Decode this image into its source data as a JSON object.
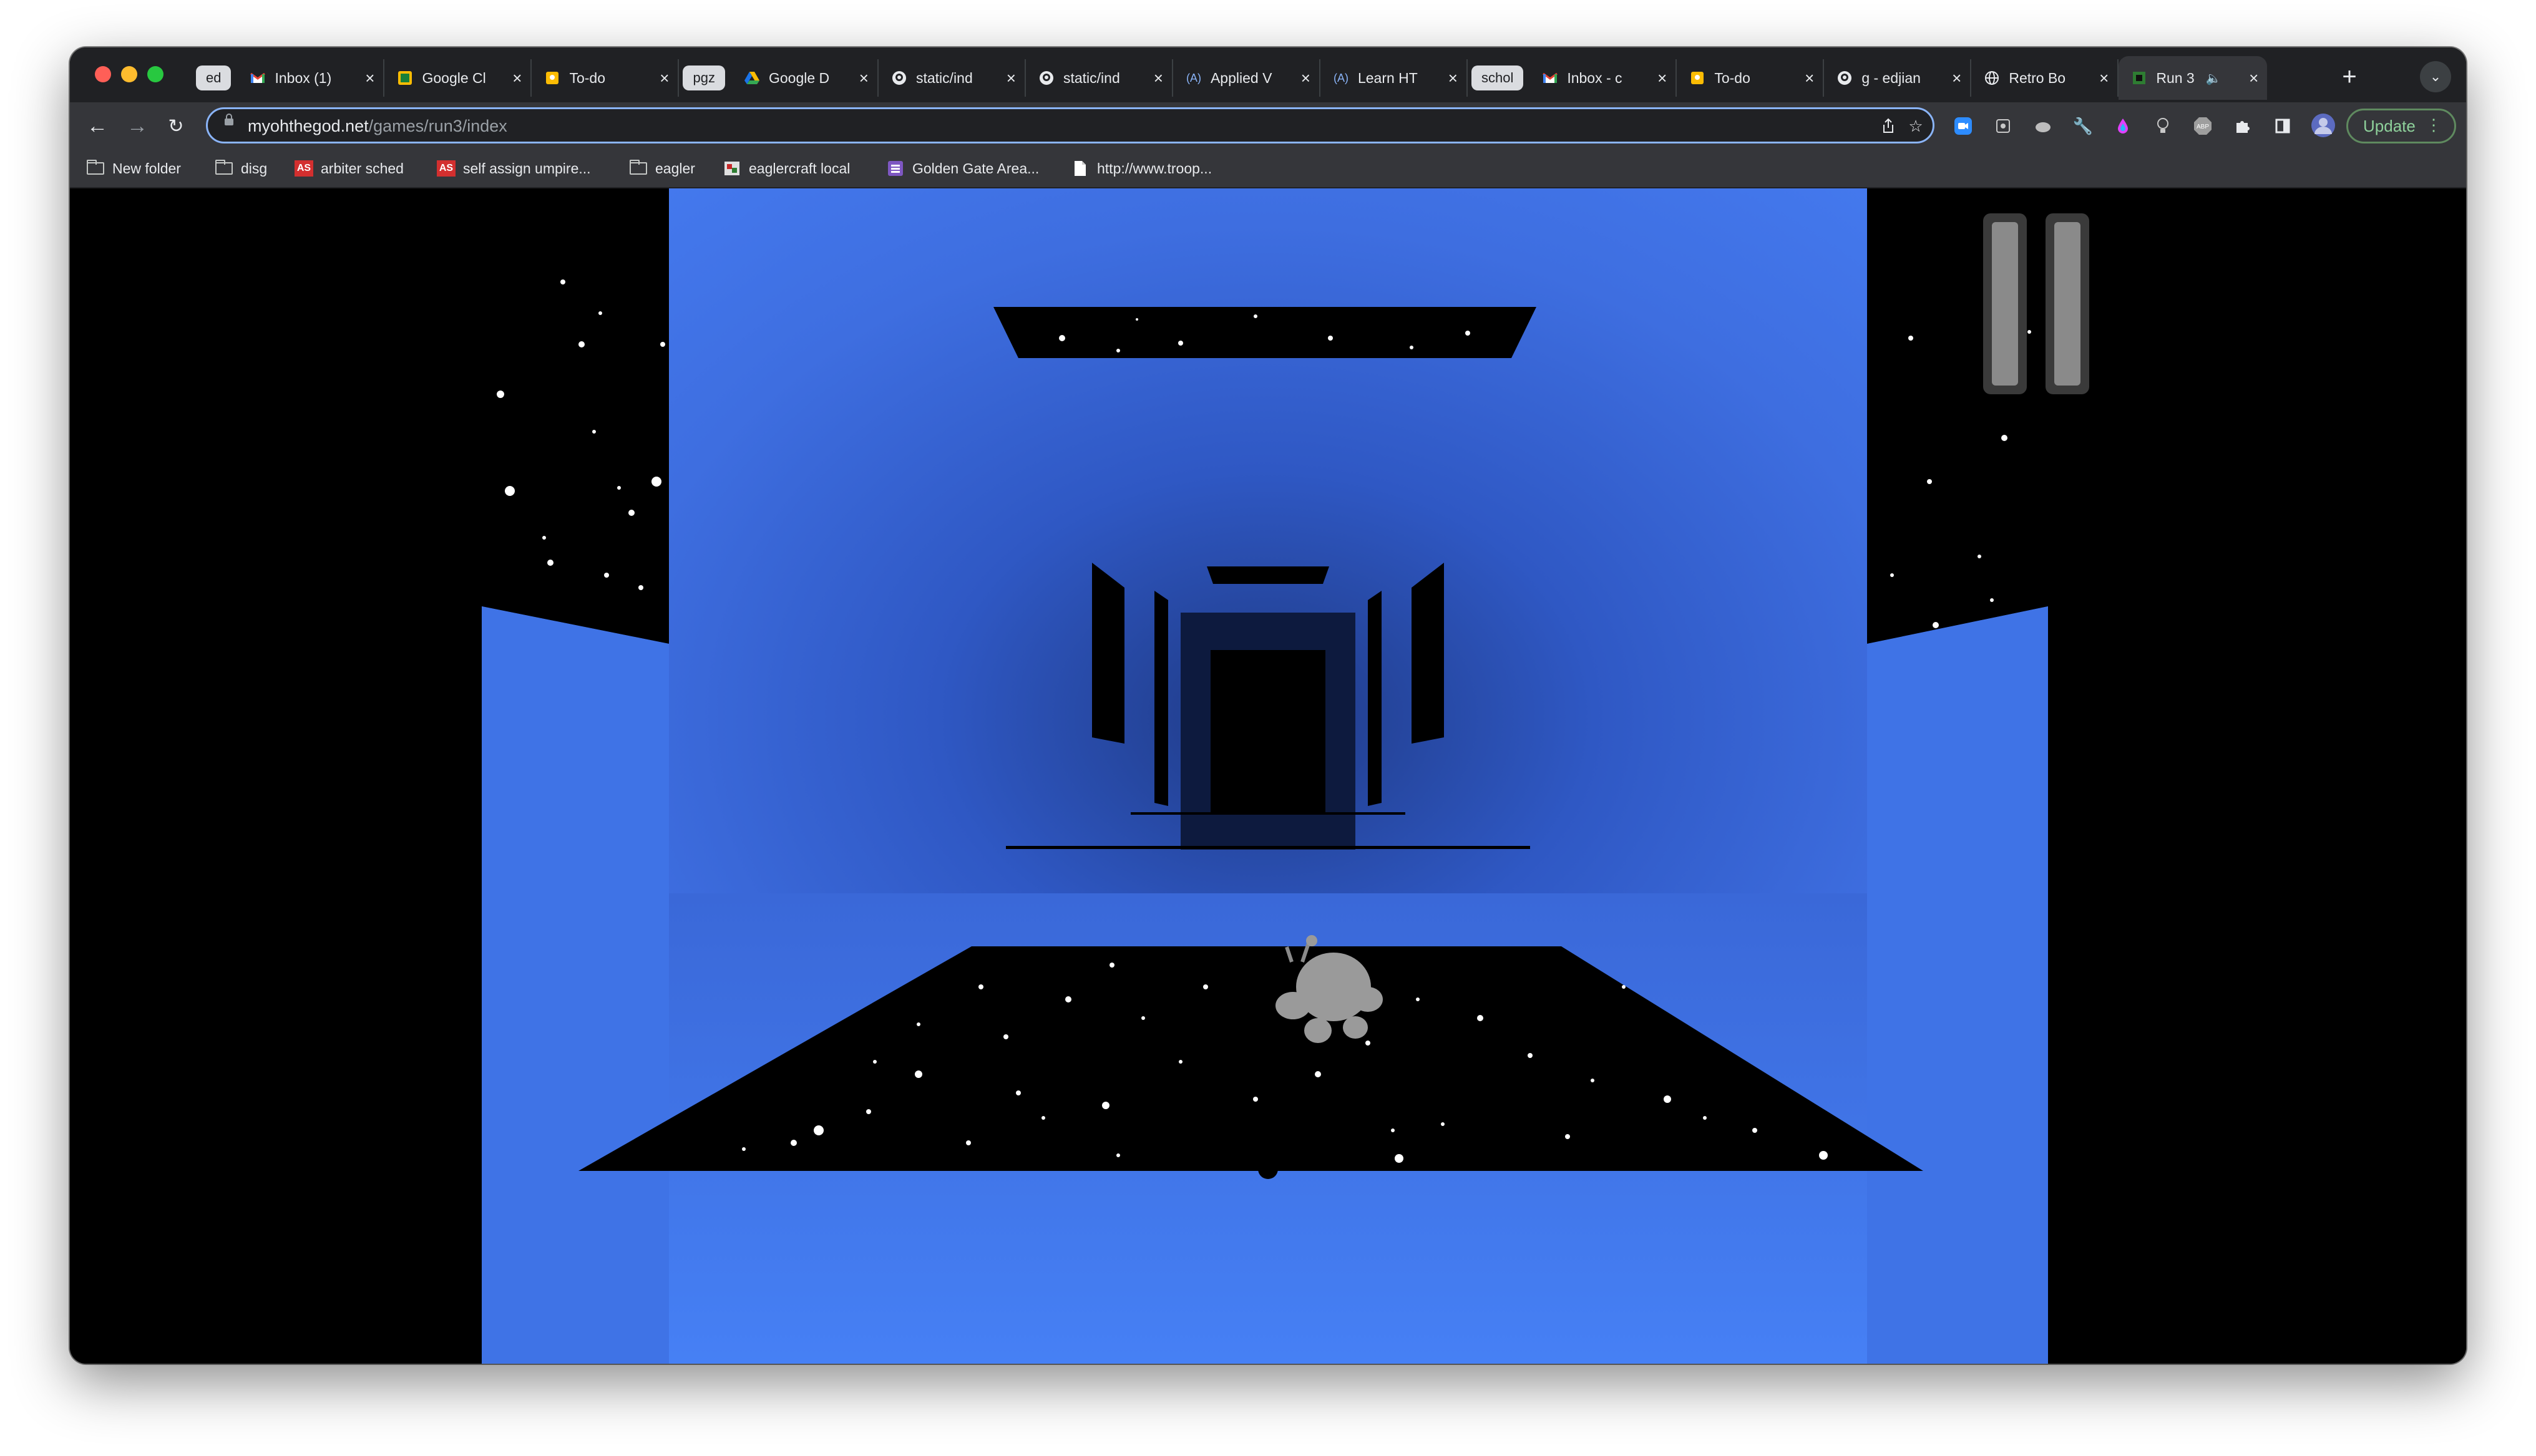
{
  "tab_strip": {
    "groups": [
      "ed",
      "pgz",
      "schol"
    ],
    "tabs": [
      {
        "group": "ed",
        "title": "Inbox (1)",
        "icon": "gmail-icon"
      },
      {
        "group": "ed",
        "title": "Google Cl",
        "icon": "google-classroom-icon"
      },
      {
        "group": "ed",
        "title": "To-do",
        "icon": "google-keep-icon"
      },
      {
        "group": "pgz",
        "title": "Google D",
        "icon": "google-drive-icon"
      },
      {
        "group": "pgz",
        "title": "static/ind",
        "icon": "github-icon"
      },
      {
        "group": "pgz",
        "title": "static/ind",
        "icon": "github-icon"
      },
      {
        "group": "pgz",
        "title": "Applied V",
        "icon": "code-icon"
      },
      {
        "group": "pgz",
        "title": "Learn HT",
        "icon": "code-icon"
      },
      {
        "group": "schol",
        "title": "Inbox - c",
        "icon": "gmail-icon"
      },
      {
        "group": "schol",
        "title": "To-do",
        "icon": "google-keep-icon"
      },
      {
        "group": "schol",
        "title": "g - edjian",
        "icon": "github-icon"
      },
      {
        "group": "schol",
        "title": "Retro Bo",
        "icon": "globe-icon"
      },
      {
        "group": "schol",
        "title": "Run 3",
        "icon": "run3-icon",
        "active": true,
        "audio": true
      }
    ]
  },
  "toolbar": {
    "url_host": "myohthegod.net",
    "url_path": "/games/run3/index",
    "update_label": "Update"
  },
  "bookmarks": [
    {
      "label": "New folder",
      "icon": "folder-icon"
    },
    {
      "label": "disg",
      "icon": "folder-icon"
    },
    {
      "label": "arbiter sched",
      "icon": "arbiter-icon"
    },
    {
      "label": "self assign umpire...",
      "icon": "arbiter-icon"
    },
    {
      "label": "eagler",
      "icon": "folder-icon"
    },
    {
      "label": "eaglercraft local",
      "icon": "eaglercraft-icon"
    },
    {
      "label": "Golden Gate Area...",
      "icon": "list-icon"
    },
    {
      "label": "http://www.troop...",
      "icon": "page-icon"
    }
  ],
  "colors": {
    "tunnel_blue": "#4479ee",
    "tunnel_shadow": "#2a4fae",
    "space": "#000000",
    "alien": "#9a9a9a"
  },
  "game": {
    "title": "Run 3",
    "pause_icon": "pause-icon",
    "player_icon": "grey-alien-runner-icon"
  }
}
